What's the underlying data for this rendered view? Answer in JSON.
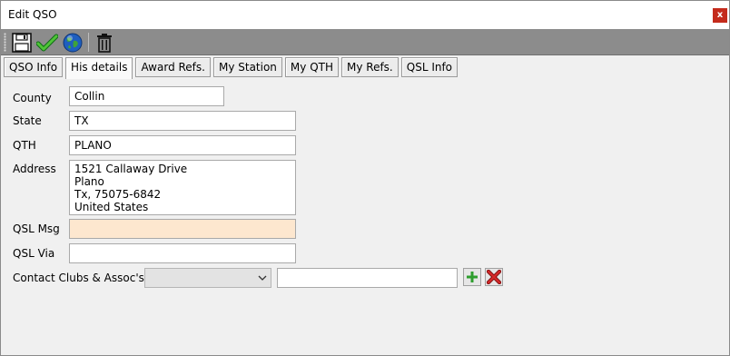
{
  "window": {
    "title": "Edit QSO",
    "close_label": "x"
  },
  "toolbar": {
    "icons": [
      "save-icon",
      "checkmark-icon",
      "globe-icon",
      "trash-icon"
    ]
  },
  "tabs": [
    {
      "label": "QSO Info",
      "active": false
    },
    {
      "label": "His details",
      "active": true
    },
    {
      "label": "Award Refs.",
      "active": false
    },
    {
      "label": "My Station",
      "active": false
    },
    {
      "label": "My QTH",
      "active": false
    },
    {
      "label": "My Refs.",
      "active": false
    },
    {
      "label": "QSL Info",
      "active": false
    }
  ],
  "form": {
    "county": {
      "label": "County",
      "value": "Collin"
    },
    "state": {
      "label": "State",
      "value": "TX"
    },
    "qth": {
      "label": "QTH",
      "value": "PLANO"
    },
    "address": {
      "label": "Address",
      "value": "1521 Callaway Drive\nPlano\nTx, 75075-6842\nUnited States"
    },
    "qsl_msg": {
      "label": "QSL Msg",
      "value": ""
    },
    "qsl_via": {
      "label": "QSL Via",
      "value": ""
    },
    "clubs": {
      "label": "Contact Clubs & Assoc's",
      "selected": "",
      "text": ""
    }
  },
  "colors": {
    "toolbar_bg": "#8c8c8c",
    "qsl_msg_bg": "#fde7cf",
    "close_bg": "#c42b1c"
  }
}
